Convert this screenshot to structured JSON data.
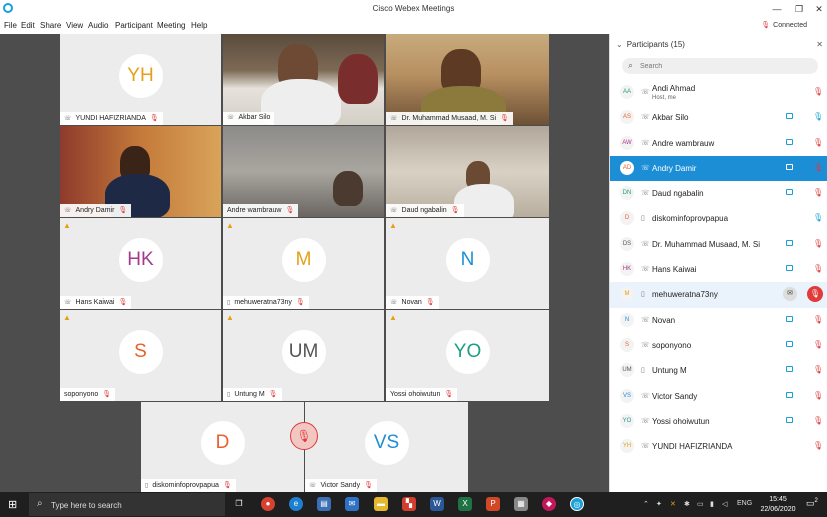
{
  "window": {
    "title": "Cisco Webex Meetings",
    "buttons": {
      "minimize": "—",
      "restore": "❐",
      "close": "✕"
    }
  },
  "menu": [
    "File",
    "Edit",
    "Share",
    "View",
    "Audio",
    "Participant",
    "Meeting",
    "Help"
  ],
  "status": {
    "connected": "Connected"
  },
  "tiles": [
    {
      "name": "YUNDI HAFIZRIANDA",
      "initials": "YH",
      "color": "#e6a017"
    },
    {
      "name": "Akbar Silo"
    },
    {
      "name": "Dr. Muhammad Musaad, M. Si"
    },
    {
      "name": "Andry Damir"
    },
    {
      "name": "Andre wambrauw"
    },
    {
      "name": "Daud ngabalin"
    },
    {
      "name": "Hans Kaiwai",
      "initials": "HK",
      "color": "#a3398c"
    },
    {
      "name": "mehuweratna73ny",
      "initials": "M",
      "color": "#e6a017"
    },
    {
      "name": "Novan",
      "initials": "N",
      "color": "#1c8ed6"
    },
    {
      "name": "soponyono",
      "initials": "S",
      "color": "#e8622c"
    },
    {
      "name": "Untung M",
      "initials": "UM",
      "color": "#555555"
    },
    {
      "name": "Yossi ohoiwutun",
      "initials": "YO",
      "color": "#1c9e87"
    },
    {
      "name": "diskominfoprovpapua",
      "initials": "D",
      "color": "#e8622c"
    },
    {
      "name": "Victor Sandy",
      "initials": "VS",
      "color": "#1c8ed6"
    }
  ],
  "panel": {
    "title": "Participants (15)",
    "close": "✕",
    "search_placeholder": "Search",
    "participants": [
      {
        "initials": "AA",
        "name": "Andi Ahmad",
        "sub": "Host, me",
        "color": "#1c9e87"
      },
      {
        "initials": "AS",
        "name": "Akbar Silo",
        "color": "#e8622c"
      },
      {
        "initials": "AW",
        "name": "Andre wambrauw",
        "color": "#a3398c"
      },
      {
        "initials": "AD",
        "name": "Andry Damir",
        "color": "#e8622c"
      },
      {
        "initials": "DN",
        "name": "Daud ngabalin",
        "color": "#1c9e87"
      },
      {
        "initials": "D",
        "name": "diskominfoprovpapua",
        "color": "#e8622c"
      },
      {
        "initials": "DS",
        "name": "Dr. Muhammad Musaad, M. Si",
        "color": "#555555"
      },
      {
        "initials": "HK",
        "name": "Hans Kaiwai",
        "color": "#a3398c"
      },
      {
        "initials": "M",
        "name": "mehuweratna73ny",
        "color": "#e6a017"
      },
      {
        "initials": "N",
        "name": "Novan",
        "color": "#1c8ed6"
      },
      {
        "initials": "S",
        "name": "soponyono",
        "color": "#e8622c"
      },
      {
        "initials": "UM",
        "name": "Untung M",
        "color": "#555555"
      },
      {
        "initials": "VS",
        "name": "Victor Sandy",
        "color": "#1c8ed6"
      },
      {
        "initials": "YO",
        "name": "Yossi ohoiwutun",
        "color": "#1c9e87"
      },
      {
        "initials": "YH",
        "name": "YUNDI HAFIZRIANDA",
        "color": "#e6a017"
      }
    ]
  },
  "taskbar": {
    "search_placeholder": "Type here to search",
    "language": "ENG",
    "time": "15:45",
    "date": "22/06/2020",
    "notifications": "2"
  }
}
